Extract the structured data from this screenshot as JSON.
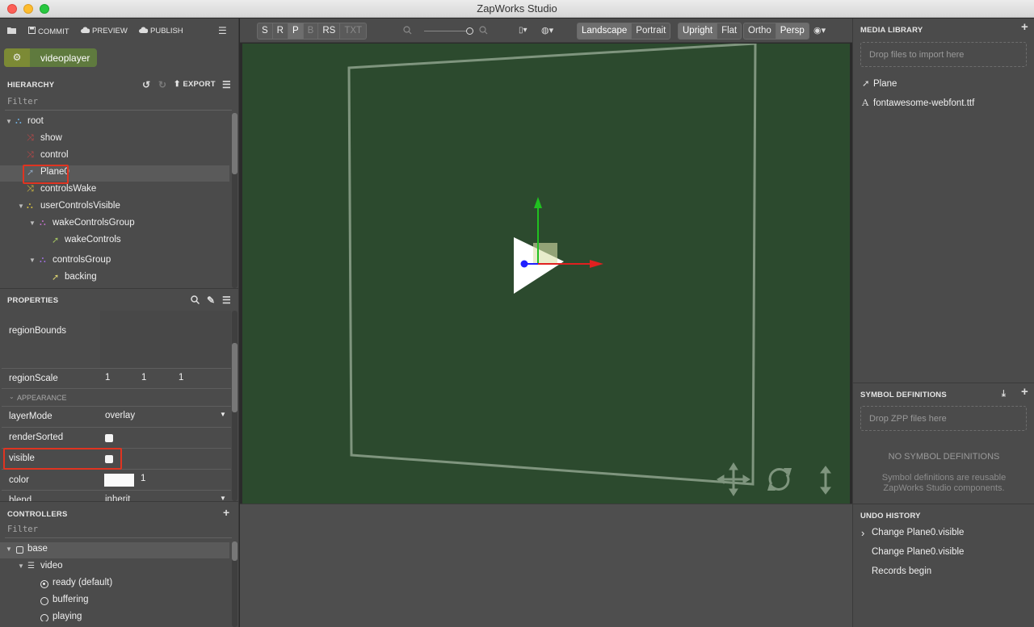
{
  "window": {
    "title": "ZapWorks Studio"
  },
  "toolbar_left": {
    "commit": "COMMIT",
    "preview": "PREVIEW",
    "publish": "PUBLISH"
  },
  "project": {
    "name": "videoplayer"
  },
  "hierarchy": {
    "header": "HIERARCHY",
    "export_label": "EXPORT",
    "filter_placeholder": "Filter",
    "nodes": [
      {
        "label": "root",
        "icon": "group-icon",
        "color": "#6fb0e0"
      },
      {
        "label": "show",
        "icon": "shuffle-icon",
        "color": "#c04848"
      },
      {
        "label": "control",
        "icon": "shuffle-icon",
        "color": "#c04848"
      },
      {
        "label": "Plane0",
        "icon": "rocket-icon",
        "color": "#8aa0b8"
      },
      {
        "label": "controlsWake",
        "icon": "shuffle-icon",
        "color": "#d8c040"
      },
      {
        "label": "userControlsVisible",
        "icon": "group-icon",
        "color": "#d8c040"
      },
      {
        "label": "wakeControlsGroup",
        "icon": "group-icon",
        "color": "#c070c8"
      },
      {
        "label": "wakeControls",
        "icon": "rocket-icon",
        "color": "#a0c060"
      },
      {
        "label": "controlsGroup",
        "icon": "group-icon",
        "color": "#a070e0"
      },
      {
        "label": "backing",
        "icon": "rocket-icon",
        "color": "#d8d070"
      }
    ]
  },
  "properties": {
    "header": "PROPERTIES",
    "region_bounds": "regionBounds",
    "region_scale": "regionScale",
    "region_scale_values": [
      "1",
      "1",
      "1"
    ],
    "appearance_section": "APPEARANCE",
    "layer_mode": "layerMode",
    "layer_mode_value": "overlay",
    "render_sorted": "renderSorted",
    "visible": "visible",
    "color": "color",
    "color_alpha": "1",
    "blend": "blend",
    "blend_value": "inherit"
  },
  "controllers": {
    "header": "CONTROLLERS",
    "filter_placeholder": "Filter",
    "items": [
      {
        "label": "base"
      },
      {
        "label": "video"
      },
      {
        "label": "ready (default)"
      },
      {
        "label": "buffering"
      },
      {
        "label": "playing"
      }
    ]
  },
  "view_toolbar": {
    "modes": [
      "S",
      "R",
      "P",
      "B",
      "RS",
      "TXT"
    ],
    "active_mode": "P",
    "orientation": [
      "Landscape",
      "Portrait"
    ],
    "active_orientation": "Landscape",
    "pose": [
      "Upright",
      "Flat"
    ],
    "active_pose": "Upright",
    "projection": [
      "Ortho",
      "Persp"
    ],
    "active_projection": "Persp"
  },
  "viewport": {
    "background": "#2c4a2e",
    "gizmo_x_color": "#e02020",
    "gizmo_y_color": "#20c020",
    "gizmo_z_color": "#2020ff"
  },
  "media_library": {
    "header": "MEDIA LIBRARY",
    "drop_hint": "Drop files to import here",
    "items": [
      {
        "label": "Plane",
        "icon": "rocket-icon"
      },
      {
        "label": "fontawesome-webfont.ttf",
        "icon": "font-icon"
      }
    ]
  },
  "symbol_definitions": {
    "header": "SYMBOL DEFINITIONS",
    "drop_hint": "Drop ZPP files here",
    "empty_title": "NO SYMBOL DEFINITIONS",
    "empty_desc_line1": "Symbol definitions are reusable",
    "empty_desc_line2": "ZapWorks Studio components."
  },
  "undo_history": {
    "header": "UNDO HISTORY",
    "items": [
      {
        "label": "Change Plane0.visible",
        "current": true
      },
      {
        "label": "Change Plane0.visible",
        "current": false
      },
      {
        "label": "Records begin",
        "current": false
      }
    ]
  }
}
